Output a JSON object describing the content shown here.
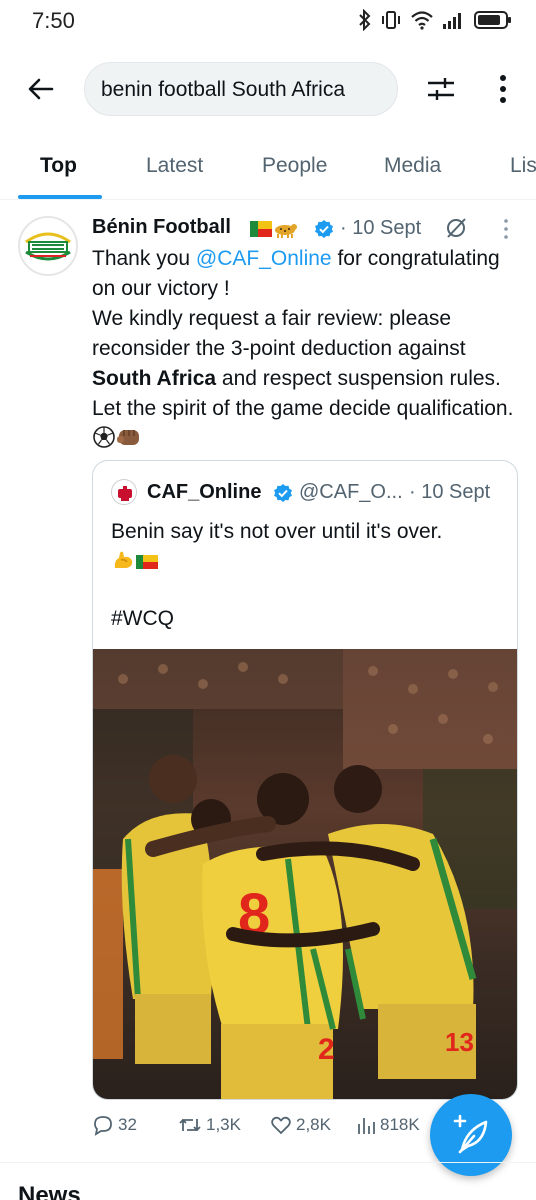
{
  "status_bar": {
    "time": "7:50",
    "battery_level": 0.85
  },
  "search": {
    "query": "benin football South Africa",
    "back_icon": "arrow-left-icon",
    "filter_icon": "sliders-icon",
    "more_icon": "more-vertical-icon"
  },
  "tabs": [
    {
      "label": "Top",
      "active": true
    },
    {
      "label": "Latest",
      "active": false
    },
    {
      "label": "People",
      "active": false
    },
    {
      "label": "Media",
      "active": false
    },
    {
      "label": "Lis",
      "active": false
    }
  ],
  "tweet": {
    "author": "Bénin Football",
    "date": "· 10 Sept",
    "text_line1_a": "Thank you ",
    "mention": "@CAF_Online",
    "text_line1_b": " for congratulating on our victory !",
    "text_line2": "We kindly request a fair review: please reconsider the 3-point deduction against ",
    "bold_text": "South Africa",
    "text_line3": " and respect suspension rules. Let the spirit of the game decide qualification. "
  },
  "quote": {
    "author": "CAF_Online",
    "handle": "@CAF_O...",
    "date": "· 10 Sept",
    "text": "Benin say it's not over until it's over.",
    "hashtag": "#WCQ"
  },
  "actions": {
    "replies": "32",
    "reposts": "1,3K",
    "likes": "2,8K",
    "views": "818K"
  },
  "next_section": "News",
  "colors": {
    "accent": "#1d9bf0",
    "text": "#0f1419",
    "muted": "#536471"
  }
}
